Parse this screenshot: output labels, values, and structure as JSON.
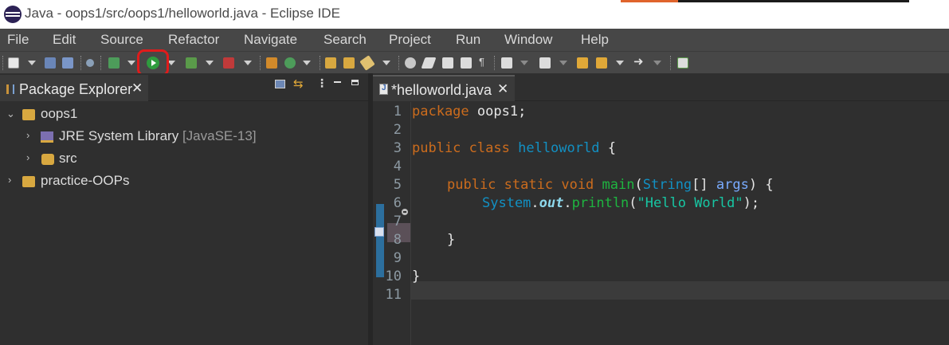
{
  "window": {
    "title": "Java - oops1/src/oops1/helloworld.java - Eclipse IDE"
  },
  "menu": {
    "items": [
      {
        "label": "File"
      },
      {
        "label": "Edit"
      },
      {
        "label": "Source"
      },
      {
        "label": "Refactor"
      },
      {
        "label": "Navigate"
      },
      {
        "label": "Search"
      },
      {
        "label": "Project"
      },
      {
        "label": "Run"
      },
      {
        "label": "Window"
      },
      {
        "label": "Help"
      }
    ]
  },
  "toolbar": {
    "highlighted_button": "run-button",
    "highlight_color": "#e01b1b"
  },
  "package_explorer": {
    "title": "Package Explorer",
    "close": "✕",
    "tree": [
      {
        "label": "oops1",
        "expanded": true
      },
      {
        "label": "JRE System Library",
        "suffix": "[JavaSE-13]"
      },
      {
        "label": "src"
      },
      {
        "label": "practice-OOPs"
      }
    ]
  },
  "editor": {
    "tab_label": "*helloworld.java",
    "close": "✕",
    "line_numbers": [
      "1",
      "2",
      "3",
      "4",
      "5",
      "6",
      "7",
      "8",
      "9",
      "10",
      "11"
    ],
    "code": {
      "l1_kw": "package",
      "l1_rest": " oops1;",
      "l3_kw1": "public",
      "l3_kw2": "class",
      "l3_type": "helloworld",
      "l3_rest": " {",
      "l5_kw1": "public",
      "l5_kw2": "static",
      "l5_kw3": "void",
      "l5_meth": "main",
      "l5_p1": "(",
      "l5_type": "String",
      "l5_p2": "[] ",
      "l5_param": "args",
      "l5_p3": ") {",
      "l6_type": "System",
      "l6_dot1": ".",
      "l6_field": "out",
      "l6_dot2": ".",
      "l6_meth": "println",
      "l6_p1": "(",
      "l6_str": "\"Hello World\"",
      "l6_p2": ");",
      "l8": "}",
      "l10": "}"
    }
  }
}
